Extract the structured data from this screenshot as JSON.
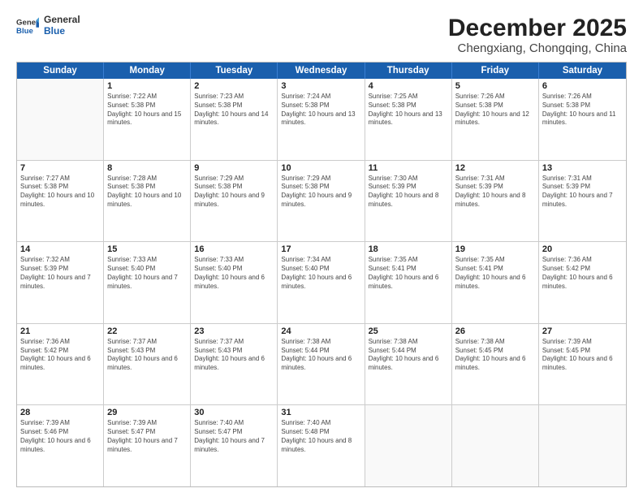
{
  "logo": {
    "line1": "General",
    "line2": "Blue"
  },
  "title": "December 2025",
  "subtitle": "Chengxiang, Chongqing, China",
  "days": [
    "Sunday",
    "Monday",
    "Tuesday",
    "Wednesday",
    "Thursday",
    "Friday",
    "Saturday"
  ],
  "weeks": [
    [
      {
        "day": "",
        "sunrise": "",
        "sunset": "",
        "daylight": ""
      },
      {
        "day": "1",
        "sunrise": "7:22 AM",
        "sunset": "5:38 PM",
        "daylight": "10 hours and 15 minutes."
      },
      {
        "day": "2",
        "sunrise": "7:23 AM",
        "sunset": "5:38 PM",
        "daylight": "10 hours and 14 minutes."
      },
      {
        "day": "3",
        "sunrise": "7:24 AM",
        "sunset": "5:38 PM",
        "daylight": "10 hours and 13 minutes."
      },
      {
        "day": "4",
        "sunrise": "7:25 AM",
        "sunset": "5:38 PM",
        "daylight": "10 hours and 13 minutes."
      },
      {
        "day": "5",
        "sunrise": "7:26 AM",
        "sunset": "5:38 PM",
        "daylight": "10 hours and 12 minutes."
      },
      {
        "day": "6",
        "sunrise": "7:26 AM",
        "sunset": "5:38 PM",
        "daylight": "10 hours and 11 minutes."
      }
    ],
    [
      {
        "day": "7",
        "sunrise": "7:27 AM",
        "sunset": "5:38 PM",
        "daylight": "10 hours and 10 minutes."
      },
      {
        "day": "8",
        "sunrise": "7:28 AM",
        "sunset": "5:38 PM",
        "daylight": "10 hours and 10 minutes."
      },
      {
        "day": "9",
        "sunrise": "7:29 AM",
        "sunset": "5:38 PM",
        "daylight": "10 hours and 9 minutes."
      },
      {
        "day": "10",
        "sunrise": "7:29 AM",
        "sunset": "5:38 PM",
        "daylight": "10 hours and 9 minutes."
      },
      {
        "day": "11",
        "sunrise": "7:30 AM",
        "sunset": "5:39 PM",
        "daylight": "10 hours and 8 minutes."
      },
      {
        "day": "12",
        "sunrise": "7:31 AM",
        "sunset": "5:39 PM",
        "daylight": "10 hours and 8 minutes."
      },
      {
        "day": "13",
        "sunrise": "7:31 AM",
        "sunset": "5:39 PM",
        "daylight": "10 hours and 7 minutes."
      }
    ],
    [
      {
        "day": "14",
        "sunrise": "7:32 AM",
        "sunset": "5:39 PM",
        "daylight": "10 hours and 7 minutes."
      },
      {
        "day": "15",
        "sunrise": "7:33 AM",
        "sunset": "5:40 PM",
        "daylight": "10 hours and 7 minutes."
      },
      {
        "day": "16",
        "sunrise": "7:33 AM",
        "sunset": "5:40 PM",
        "daylight": "10 hours and 6 minutes."
      },
      {
        "day": "17",
        "sunrise": "7:34 AM",
        "sunset": "5:40 PM",
        "daylight": "10 hours and 6 minutes."
      },
      {
        "day": "18",
        "sunrise": "7:35 AM",
        "sunset": "5:41 PM",
        "daylight": "10 hours and 6 minutes."
      },
      {
        "day": "19",
        "sunrise": "7:35 AM",
        "sunset": "5:41 PM",
        "daylight": "10 hours and 6 minutes."
      },
      {
        "day": "20",
        "sunrise": "7:36 AM",
        "sunset": "5:42 PM",
        "daylight": "10 hours and 6 minutes."
      }
    ],
    [
      {
        "day": "21",
        "sunrise": "7:36 AM",
        "sunset": "5:42 PM",
        "daylight": "10 hours and 6 minutes."
      },
      {
        "day": "22",
        "sunrise": "7:37 AM",
        "sunset": "5:43 PM",
        "daylight": "10 hours and 6 minutes."
      },
      {
        "day": "23",
        "sunrise": "7:37 AM",
        "sunset": "5:43 PM",
        "daylight": "10 hours and 6 minutes."
      },
      {
        "day": "24",
        "sunrise": "7:38 AM",
        "sunset": "5:44 PM",
        "daylight": "10 hours and 6 minutes."
      },
      {
        "day": "25",
        "sunrise": "7:38 AM",
        "sunset": "5:44 PM",
        "daylight": "10 hours and 6 minutes."
      },
      {
        "day": "26",
        "sunrise": "7:38 AM",
        "sunset": "5:45 PM",
        "daylight": "10 hours and 6 minutes."
      },
      {
        "day": "27",
        "sunrise": "7:39 AM",
        "sunset": "5:45 PM",
        "daylight": "10 hours and 6 minutes."
      }
    ],
    [
      {
        "day": "28",
        "sunrise": "7:39 AM",
        "sunset": "5:46 PM",
        "daylight": "10 hours and 6 minutes."
      },
      {
        "day": "29",
        "sunrise": "7:39 AM",
        "sunset": "5:47 PM",
        "daylight": "10 hours and 7 minutes."
      },
      {
        "day": "30",
        "sunrise": "7:40 AM",
        "sunset": "5:47 PM",
        "daylight": "10 hours and 7 minutes."
      },
      {
        "day": "31",
        "sunrise": "7:40 AM",
        "sunset": "5:48 PM",
        "daylight": "10 hours and 8 minutes."
      },
      {
        "day": "",
        "sunrise": "",
        "sunset": "",
        "daylight": ""
      },
      {
        "day": "",
        "sunrise": "",
        "sunset": "",
        "daylight": ""
      },
      {
        "day": "",
        "sunrise": "",
        "sunset": "",
        "daylight": ""
      }
    ]
  ]
}
